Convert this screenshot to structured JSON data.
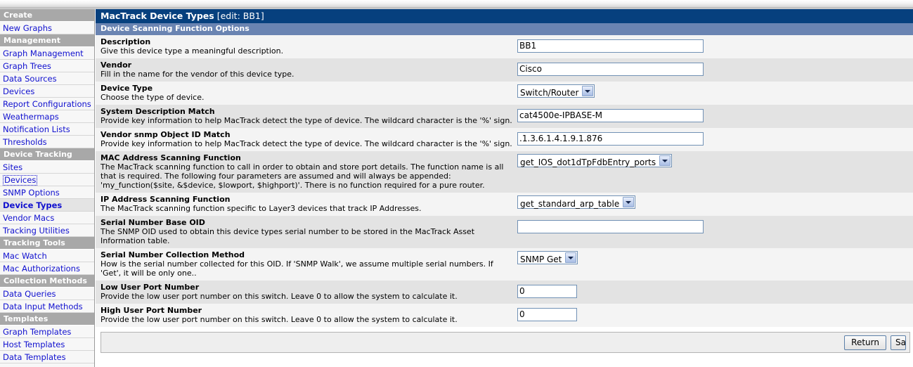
{
  "sidebar": {
    "groups": [
      {
        "header": "Create",
        "items": [
          {
            "label": "New Graphs",
            "state": "normal"
          }
        ]
      },
      {
        "header": "Management",
        "items": [
          {
            "label": "Graph Management",
            "state": "normal"
          },
          {
            "label": "Graph Trees",
            "state": "normal"
          },
          {
            "label": "Data Sources",
            "state": "normal"
          },
          {
            "label": "Devices",
            "state": "normal"
          },
          {
            "label": "Report Configurations",
            "state": "normal"
          },
          {
            "label": "Weathermaps",
            "state": "normal"
          },
          {
            "label": "Notification Lists",
            "state": "normal"
          },
          {
            "label": "Thresholds",
            "state": "normal"
          }
        ]
      },
      {
        "header": "Device Tracking",
        "items": [
          {
            "label": "Sites",
            "state": "normal"
          },
          {
            "label": "Devices",
            "state": "focused"
          },
          {
            "label": "SNMP Options",
            "state": "normal"
          },
          {
            "label": "Device Types",
            "state": "current"
          },
          {
            "label": "Vendor Macs",
            "state": "normal"
          },
          {
            "label": "Tracking Utilities",
            "state": "normal"
          }
        ]
      },
      {
        "header": "Tracking Tools",
        "items": [
          {
            "label": "Mac Watch",
            "state": "normal"
          },
          {
            "label": "Mac Authorizations",
            "state": "normal"
          }
        ]
      },
      {
        "header": "Collection Methods",
        "items": [
          {
            "label": "Data Queries",
            "state": "normal"
          },
          {
            "label": "Data Input Methods",
            "state": "normal"
          }
        ]
      },
      {
        "header": "Templates",
        "items": [
          {
            "label": "Graph Templates",
            "state": "normal"
          },
          {
            "label": "Host Templates",
            "state": "normal"
          },
          {
            "label": "Data Templates",
            "state": "normal"
          }
        ]
      }
    ]
  },
  "main": {
    "page_title": "MacTrack Device Types",
    "page_title_edit": "[edit: BB1]",
    "section_title": "Device Scanning Function Options",
    "fields": [
      {
        "label": "Description",
        "description": "Give this device type a meaningful description.",
        "control": "text",
        "value": "BB1",
        "name": "description-input",
        "width": "w265"
      },
      {
        "label": "Vendor",
        "description": "Fill in the name for the vendor of this device type.",
        "control": "text",
        "value": "Cisco",
        "name": "vendor-input",
        "width": "w265"
      },
      {
        "label": "Device Type",
        "description": "Choose the type of device.",
        "control": "select",
        "value": "Switch/Router",
        "name": "device-type-select",
        "width": "sw-108"
      },
      {
        "label": "System Description Match",
        "description": "Provide key information to help MacTrack detect the type of device. The wildcard character is the '%' sign.",
        "control": "text",
        "value": "cat4500e-IPBASE-M",
        "name": "system-description-match-input",
        "width": "w265"
      },
      {
        "label": "Vendor snmp Object ID Match",
        "description": "Provide key information to help MacTrack detect the type of device. The wildcard character is the '%' sign.",
        "control": "text",
        "value": ".1.3.6.1.4.1.9.1.876",
        "name": "vendor-snmp-oid-match-input",
        "width": "w265"
      },
      {
        "label": "MAC Address Scanning Function",
        "description": "The MacTrack scanning function to call in order to obtain and store port details. The function name is all that is required. The following four parameters are assumed and will always be appended: 'my_function($site, &$device, $lowport, $highport)'. There is no function required for a pure router.",
        "control": "select",
        "value": "get_IOS_dot1dTpFdbEntry_ports",
        "name": "mac-address-scanning-function-select",
        "width": "sw-260"
      },
      {
        "label": "IP Address Scanning Function",
        "description": "The MacTrack scanning function specific to Layer3 devices that track IP Addresses.",
        "control": "select",
        "value": "get_standard_arp_table",
        "name": "ip-address-scanning-function-select",
        "width": "sw-246"
      },
      {
        "label": "Serial Number Base OID",
        "description": "The SNMP OID used to obtain this device types serial number to be stored in the MacTrack Asset Information table.",
        "control": "text",
        "value": "",
        "name": "serial-number-base-oid-input",
        "width": "w265"
      },
      {
        "label": "Serial Number Collection Method",
        "description": "How is the serial number collected for this OID. If 'SNMP Walk', we assume multiple serial numbers. If 'Get', it will be only one..",
        "control": "select",
        "value": "SNMP Get",
        "name": "serial-number-collection-method-select",
        "width": "sw-97"
      },
      {
        "label": "Low User Port Number",
        "description": "Provide the low user port number on this switch. Leave 0 to allow the system to calculate it.",
        "control": "text",
        "value": "0",
        "name": "low-user-port-number-input",
        "width": "w85"
      },
      {
        "label": "High User Port Number",
        "description": "Provide the low user port number on this switch. Leave 0 to allow the system to calculate it.",
        "control": "text",
        "value": "0",
        "name": "high-user-port-number-input",
        "width": "w85"
      }
    ],
    "buttons": {
      "return_label": "Return",
      "save_label": "Save"
    }
  },
  "colors": {
    "title_bar": "#06407e",
    "section_bar": "#6a84b2",
    "nav_header": "#a8a8a8",
    "link": "#1010cf",
    "row_odd": "#f4f4f4",
    "row_even": "#e3e3e3"
  }
}
